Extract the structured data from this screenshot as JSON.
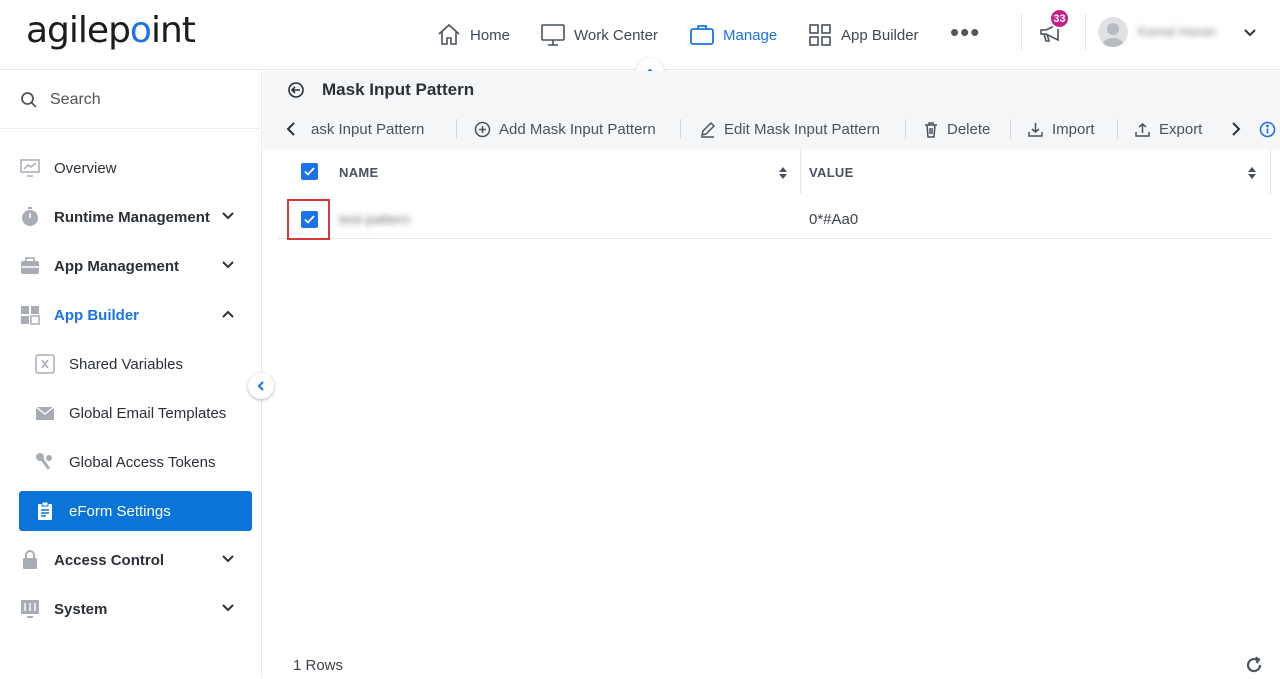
{
  "brand": {
    "logo_text_1": "agilep",
    "logo_text_2": "int"
  },
  "topnav": [
    {
      "label": "Home",
      "icon": "home-icon",
      "active": false
    },
    {
      "label": "Work Center",
      "icon": "monitor-icon",
      "active": false
    },
    {
      "label": "Manage",
      "icon": "briefcase-icon",
      "active": true
    },
    {
      "label": "App Builder",
      "icon": "grid-icon",
      "active": false
    }
  ],
  "more_label": "•••",
  "notifications": {
    "count": "33",
    "icon": "megaphone-icon"
  },
  "user": {
    "name": "Kamal Hasan"
  },
  "sidebar": {
    "search_placeholder": "Search",
    "items": [
      {
        "label": "Overview",
        "icon": "chart-monitor-icon"
      },
      {
        "label": "Runtime Management",
        "icon": "stopwatch-icon",
        "expandable": true
      },
      {
        "label": "App Management",
        "icon": "toolbox-icon",
        "expandable": true
      },
      {
        "label": "App Builder",
        "icon": "app-grid-icon",
        "expanded": true
      },
      {
        "label": "Shared Variables",
        "icon": "variable-icon"
      },
      {
        "label": "Global Email Templates",
        "icon": "envelope-icon"
      },
      {
        "label": "Global Access Tokens",
        "icon": "keys-icon"
      },
      {
        "label": "eForm Settings",
        "icon": "clipboard-icon",
        "selected": true
      },
      {
        "label": "Access Control",
        "icon": "lock-icon",
        "expandable": true
      },
      {
        "label": "System",
        "icon": "sliders-icon",
        "expandable": true
      }
    ]
  },
  "page": {
    "title": "Mask Input Pattern"
  },
  "toolbar": {
    "breadcrumb": "ask Input Pattern",
    "add": "Add Mask Input Pattern",
    "edit": "Edit Mask Input Pattern",
    "delete": "Delete",
    "import": "Import",
    "export": "Export"
  },
  "table": {
    "columns": [
      "NAME",
      "VALUE"
    ],
    "rows": [
      {
        "name": "test-pattern",
        "value": "0*#Aa0",
        "selected": true
      }
    ],
    "footer": "1 Rows"
  },
  "colors": {
    "accent": "#1a73e8",
    "selected_bg": "#0b74d8",
    "badge": "#c41e88",
    "focus": "#d9383a"
  }
}
